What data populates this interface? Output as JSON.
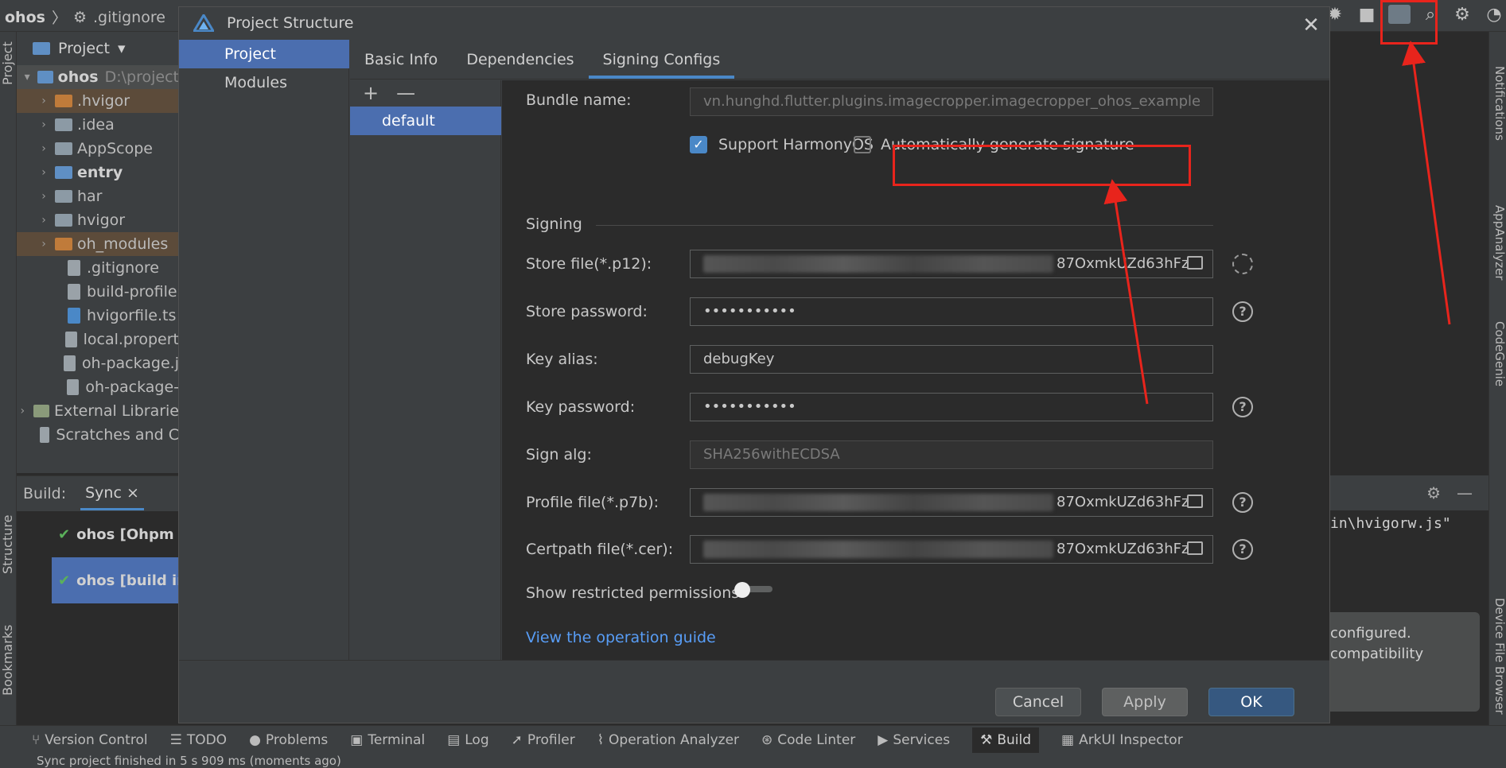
{
  "ide": {
    "crumb_root": "ohos",
    "crumb_file": ".gitignore",
    "project_panel_title": "Project",
    "left_strip": {
      "project": "Project",
      "structure": "Structure",
      "bookmarks": "Bookmarks"
    },
    "right_strip": {
      "notifications": "Notifications",
      "app_analyzer": "AppAnalyzer",
      "codegenie": "CodeGenie",
      "device_file_browser": "Device File Browser"
    },
    "tree": [
      {
        "name": "ohos",
        "path": "D:\\project"
      },
      {
        "name": ".hvigor"
      },
      {
        "name": ".idea"
      },
      {
        "name": "AppScope"
      },
      {
        "name": "entry"
      },
      {
        "name": "har"
      },
      {
        "name": "hvigor"
      },
      {
        "name": "oh_modules"
      },
      {
        "name": ".gitignore"
      },
      {
        "name": "build-profile"
      },
      {
        "name": "hvigorfile.ts"
      },
      {
        "name": "local.propert"
      },
      {
        "name": "oh-package.j"
      },
      {
        "name": "oh-package-"
      },
      {
        "name": "External Librarie"
      },
      {
        "name": "Scratches and C"
      }
    ],
    "build": {
      "label": "Build:",
      "tab": "Sync",
      "rows": [
        "ohos [Ohpm In",
        "ohos [build ini"
      ]
    },
    "console_text": "in\\hvigorw.js\"",
    "notification": {
      "line1": "configured.",
      "line2": "compatibility"
    },
    "toolwindows": [
      "Version Control",
      "TODO",
      "Problems",
      "Terminal",
      "Log",
      "Profiler",
      "Operation Analyzer",
      "Code Linter",
      "Services",
      "Build",
      "ArkUI Inspector"
    ],
    "status": "Sync project finished in 5 s 909 ms (moments ago)"
  },
  "dialog": {
    "title": "Project Structure",
    "nav": [
      "Project",
      "Modules"
    ],
    "tabs": [
      "Basic Info",
      "Dependencies",
      "Signing Configs"
    ],
    "configs": {
      "add": "+",
      "remove": "—",
      "items": [
        "default"
      ]
    },
    "form": {
      "bundle_name_label": "Bundle name:",
      "bundle_name_value": "vn.hunghd.flutter.plugins.imagecropper.imagecropper_ohos_example",
      "support_harmonyos": "Support HarmonyOS",
      "auto_sign": "Automatically generate signature",
      "signing_section": "Signing",
      "store_file_label": "Store file(*.p12):",
      "store_file_tail": "87OxmkUZd63hFz",
      "store_password_label": "Store password:",
      "store_password_value": "•••••••••••",
      "key_alias_label": "Key alias:",
      "key_alias_value": "debugKey",
      "key_password_label": "Key password:",
      "key_password_value": "•••••••••••",
      "sign_alg_label": "Sign alg:",
      "sign_alg_value": "SHA256withECDSA",
      "profile_file_label": "Profile file(*.p7b):",
      "profile_file_tail": "87OxmkUZd63hFz",
      "certpath_file_label": "Certpath file(*.cer):",
      "certpath_file_tail": "87OxmkUZd63hFz",
      "restricted_label": "Show restricted permissions",
      "guide_link": "View the operation guide"
    },
    "buttons": {
      "cancel": "Cancel",
      "apply": "Apply",
      "ok": "OK"
    }
  },
  "colors": {
    "accent": "#4b6eaf",
    "link": "#589df6",
    "annotation": "#e8241c"
  }
}
